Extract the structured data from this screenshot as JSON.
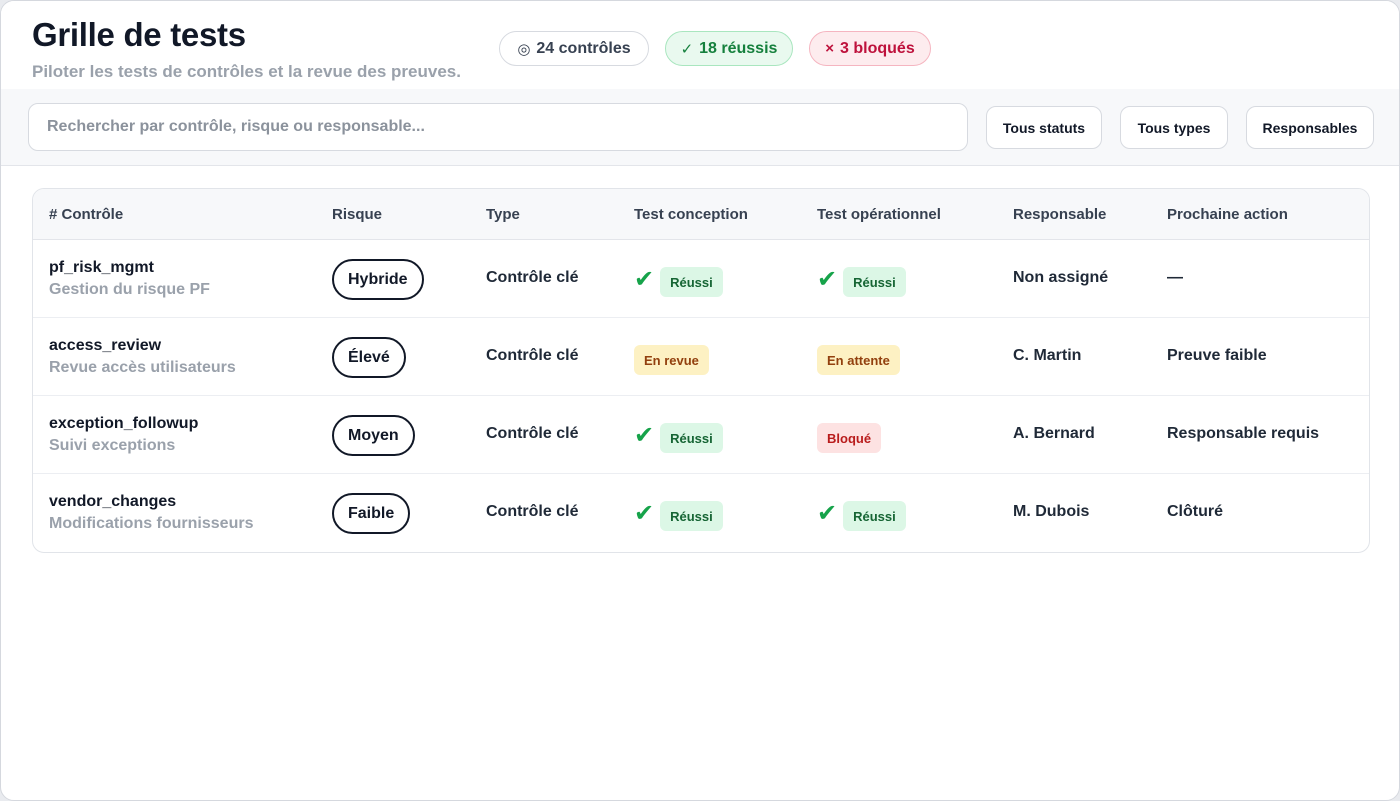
{
  "header": {
    "title": "Grille de tests",
    "subtitle": "Piloter les tests de contrôles et la revue des preuves.",
    "stats": {
      "total_icon": "◎",
      "total": "24 contrôles",
      "passed_icon": "✓",
      "passed": "18 réussis",
      "blocked_icon": "×",
      "blocked": "3 bloqués"
    }
  },
  "toolbar": {
    "search_placeholder": "Rechercher par contrôle, risque ou responsable...",
    "filters": [
      "Tous statuts",
      "Tous types",
      "Responsables"
    ]
  },
  "table": {
    "columns": [
      "# Contrôle",
      "Risque",
      "Type",
      "Test conception",
      "Test opérationnel",
      "Responsable",
      "Prochaine action"
    ],
    "rows": [
      {
        "id": "pf_risk_mgmt",
        "desc": "Gestion du risque PF",
        "risk": "Hybride",
        "type": "Contrôle clé",
        "design": {
          "label": "Réussi",
          "check": "✔"
        },
        "operational": {
          "label": "Réussi",
          "check": "✔"
        },
        "owner": "Non assigné",
        "next": "—"
      },
      {
        "id": "access_review",
        "desc": "Revue accès utilisateurs",
        "risk": "Élevé",
        "type": "Contrôle clé",
        "design": {
          "label": "En revue"
        },
        "operational": {
          "label": "En attente"
        },
        "owner": "C. Martin",
        "next": "Preuve faible"
      },
      {
        "id": "exception_followup",
        "desc": "Suivi exceptions",
        "risk": "Moyen",
        "type": "Contrôle clé",
        "design": {
          "label": "Réussi",
          "check": "✔"
        },
        "operational": {
          "label": "Bloqué"
        },
        "owner": "A. Bernard",
        "next": "Responsable requis"
      },
      {
        "id": "vendor_changes",
        "desc": "Modifications fournisseurs",
        "risk": "Faible",
        "type": "Contrôle clé",
        "design": {
          "label": "Réussi",
          "check": "✔"
        },
        "operational": {
          "label": "Réussi",
          "check": "✔"
        },
        "owner": "M. Dubois",
        "next": "Clôturé"
      }
    ]
  },
  "colors": {
    "pass": "#16a34a",
    "pass_bg": "#dcf7e6",
    "review_bg": "#fdf1c3",
    "blocked": "#b91c1c",
    "blocked_bg": "#fde2e2"
  }
}
